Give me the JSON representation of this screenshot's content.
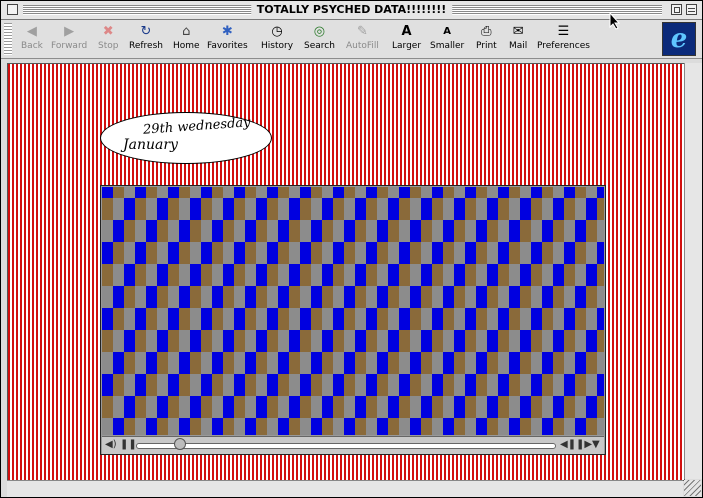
{
  "window": {
    "title": "TOTALLY PSYCHED DATA!!!!!!!!"
  },
  "toolbar": {
    "buttons": [
      {
        "label": "Back",
        "icon": "back-arrow-icon",
        "glyph": "◀",
        "enabled": false
      },
      {
        "label": "Forward",
        "icon": "forward-arrow-icon",
        "glyph": "▶",
        "enabled": false
      },
      {
        "label": "Stop",
        "icon": "stop-icon",
        "glyph": "✖",
        "enabled": false
      },
      {
        "label": "Refresh",
        "icon": "refresh-icon",
        "glyph": "↻",
        "enabled": true
      },
      {
        "label": "Home",
        "icon": "home-icon",
        "glyph": "⌂",
        "enabled": true
      },
      {
        "label": "Favorites",
        "icon": "favorites-icon",
        "glyph": "✱",
        "enabled": true
      },
      {
        "label": "History",
        "icon": "history-icon",
        "glyph": "◷",
        "enabled": true
      },
      {
        "label": "Search",
        "icon": "search-icon",
        "glyph": "◎",
        "enabled": true
      },
      {
        "label": "AutoFill",
        "icon": "autofill-icon",
        "glyph": "✎",
        "enabled": false
      },
      {
        "label": "Larger",
        "icon": "larger-text-icon",
        "glyph": "A",
        "enabled": true
      },
      {
        "label": "Smaller",
        "icon": "smaller-text-icon",
        "glyph": "A",
        "enabled": true
      },
      {
        "label": "Print",
        "icon": "print-icon",
        "glyph": "⎙",
        "enabled": true
      },
      {
        "label": "Mail",
        "icon": "mail-icon",
        "glyph": "✉",
        "enabled": true
      },
      {
        "label": "Preferences",
        "icon": "preferences-icon",
        "glyph": "☰",
        "enabled": true
      }
    ],
    "logo_icon": "ie-logo-icon",
    "logo_glyph": "e"
  },
  "page": {
    "date_line1": "29th wednesday",
    "date_line2": "January",
    "background_colors": [
      "#d20f0f",
      "#ffffff"
    ],
    "movie": {
      "pattern_colors": [
        "#0000e0",
        "#8c8c8c",
        "#8a6a3a"
      ],
      "progress": 0.09
    }
  },
  "colors": {
    "ie_logo_bg": "#0b2a7a",
    "ie_logo_fg": "#5fc6ff"
  }
}
